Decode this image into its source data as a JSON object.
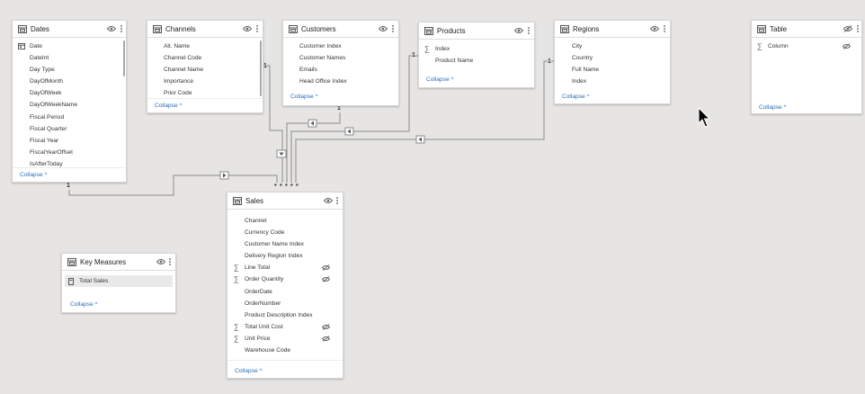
{
  "tables": {
    "dates": {
      "name": "Dates",
      "fields": [
        "Date",
        "DateInt",
        "Day Type",
        "DayOfMonth",
        "DayOfWeek",
        "DayOfWeekName",
        "Fiscal Period",
        "Fiscal Quarter",
        "Fiscal Year",
        "FiscalYearOffset",
        "IsAfterToday"
      ],
      "collapse_label": "Collapse"
    },
    "channels": {
      "name": "Channels",
      "fields": [
        "Alt. Name",
        "Channel Code",
        "Channel Name",
        "Importance",
        "Prior Code"
      ],
      "collapse_label": "Collapse"
    },
    "customers": {
      "name": "Customers",
      "fields": [
        "Customer Index",
        "Customer Names",
        "Emails",
        "Head Office Index"
      ],
      "collapse_label": "Collapse"
    },
    "products": {
      "name": "Products",
      "fields": [
        "Index",
        "Product Name"
      ],
      "collapse_label": "Collapse"
    },
    "regions": {
      "name": "Regions",
      "fields": [
        "City",
        "Country",
        "Full Name",
        "Index"
      ],
      "collapse_label": "Collapse"
    },
    "table": {
      "name": "Table",
      "fields": [
        "Column"
      ],
      "collapse_label": "Collapse"
    },
    "sales": {
      "name": "Sales",
      "fields": [
        "Channel",
        "Currency Code",
        "Customer Name Index",
        "Delivery Region Index",
        "Line Total",
        "Order Quantity",
        "OrderDate",
        "OrderNumber",
        "Product Description Index",
        "Total Unit Cost",
        "Unit Price",
        "Warehouse Code"
      ],
      "collapse_label": "Collapse"
    },
    "key_measures": {
      "name": "Key Measures",
      "fields": [
        "Total Sales"
      ],
      "collapse_label": "Collapse"
    }
  },
  "relationships": {
    "one_label": "1",
    "many_label": "*"
  },
  "colors": {
    "canvas": "#e6e5e4",
    "line": "#8a8a8a",
    "link": "#2c6fb7"
  },
  "icons": [
    "table-icon",
    "eye-icon",
    "eye-hidden-icon",
    "more-options-icon",
    "sigma-icon",
    "calendar-icon",
    "calculator-icon",
    "chevron-up-icon",
    "mouse-pointer-icon",
    "arrow-left-icon",
    "arrow-right-icon",
    "arrow-down-icon"
  ]
}
